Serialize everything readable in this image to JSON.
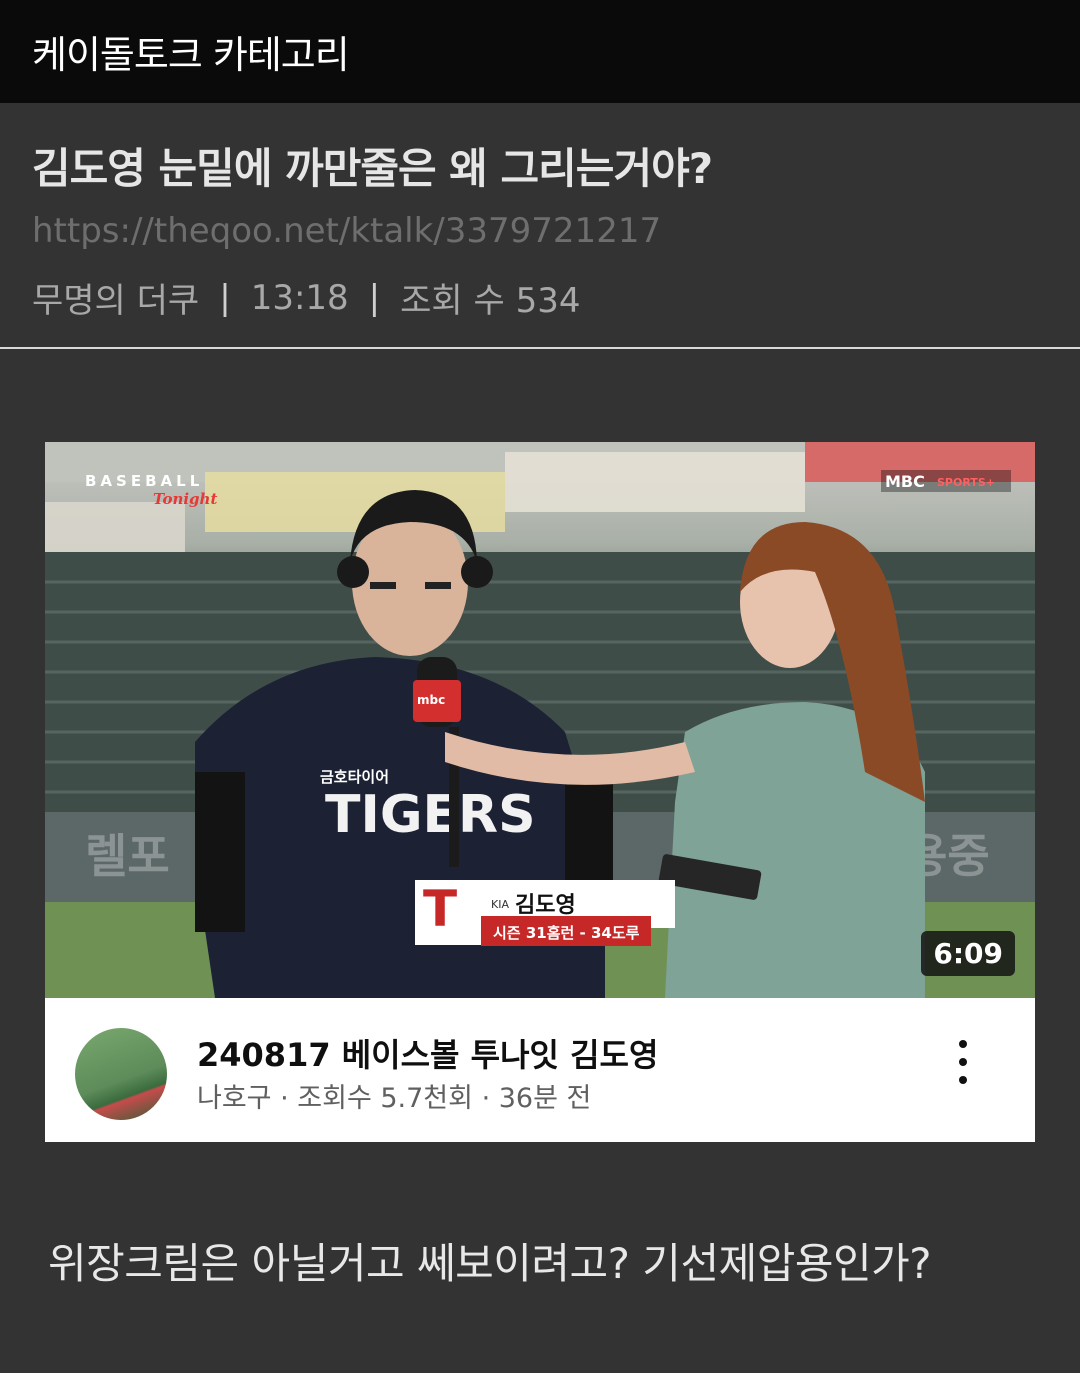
{
  "topbar": {
    "title": "케이돌토크 카테고리"
  },
  "post": {
    "title": "김도영 눈밑에 까만줄은 왜 그리는거야?",
    "url": "https://theqoo.net/ktalk/3379721217",
    "author": "무명의 더쿠",
    "time": "13:18",
    "views": "조회 수 534",
    "separator": "|"
  },
  "video": {
    "title": "240817 베이스볼 투나잇 김도영",
    "meta": "나호구 · 조회수 5.7천회 · 36분 전",
    "duration": "6:09",
    "overlay": {
      "show_logo": "BASEBALL",
      "show_logo_script": "Tonight",
      "broadcaster": "MBC SPORTS+",
      "caption_team": "KIA",
      "caption_name": "김도영",
      "caption_stats": "시즌 31홈런 - 34도루",
      "jersey": "TIGERS",
      "jersey_sponsor": "금호타이어"
    }
  },
  "body": {
    "text": "위장크림은 아닐거고 쎄보이려고? 기선제압용인가?"
  },
  "colors": {
    "background": "#333333",
    "topbar": "#0a0a0a",
    "accent_red": "#d32f2f"
  }
}
